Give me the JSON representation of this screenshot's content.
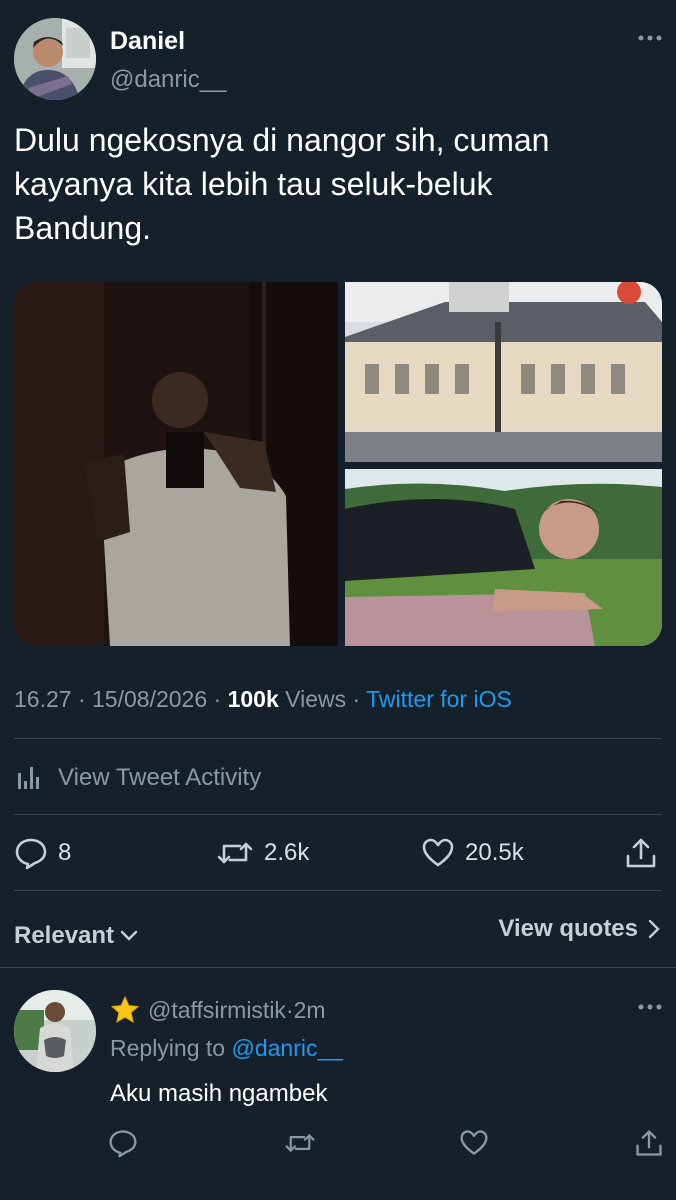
{
  "tweet": {
    "author_name": "Daniel",
    "author_handle": "@danric__",
    "text": "Dulu ngekosnya di nangor sih, cuman\nkayanya kita lebih tau seluk-beluk\nBandung.",
    "time": "16.27",
    "date": "15/08/2026",
    "views_count": "100k",
    "views_label": "Views",
    "source": "Twitter for iOS",
    "separator": " · "
  },
  "activity": {
    "label": "View Tweet Activity",
    "icon": "bar-chart-icon"
  },
  "actions": {
    "replies": "8",
    "retweets": "2.6k",
    "likes": "20.5k"
  },
  "sort": {
    "label": "Relevant",
    "quotes_label": "View quotes"
  },
  "reply": {
    "badge_icon": "star-icon",
    "handle": "@taffsirmistik",
    "time": "2m",
    "replying_prefix": "Replying to",
    "replying_handle": "@danric__",
    "text": "Aku masih ngambek"
  },
  "colors": {
    "background": "#15202b",
    "accent": "#1d9bf0",
    "muted": "#8b98a5",
    "divider": "#38444d"
  }
}
